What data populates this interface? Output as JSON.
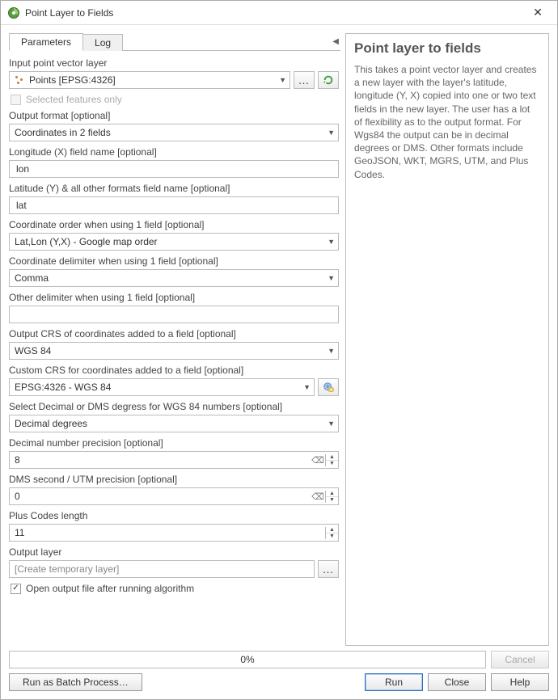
{
  "window": {
    "title": "Point Layer to Fields"
  },
  "tabs": {
    "parameters": "Parameters",
    "log": "Log"
  },
  "form": {
    "input_layer": {
      "label": "Input point vector layer",
      "value": "Points [EPSG:4326]"
    },
    "selected_only": {
      "label": "Selected features only",
      "checked": false,
      "enabled": false
    },
    "output_format": {
      "label": "Output format [optional]",
      "value": "Coordinates in 2 fields"
    },
    "lon_field": {
      "label": "Longitude (X) field name [optional]",
      "value": "lon"
    },
    "lat_field": {
      "label": "Latitude (Y) & all other formats field name [optional]",
      "value": "lat"
    },
    "coord_order": {
      "label": "Coordinate order when using 1 field [optional]",
      "value": "Lat,Lon (Y,X) - Google map order"
    },
    "coord_delim": {
      "label": "Coordinate delimiter when using 1 field [optional]",
      "value": "Comma"
    },
    "other_delim": {
      "label": "Other delimiter when using 1 field [optional]",
      "value": ""
    },
    "output_crs": {
      "label": "Output CRS of coordinates added to a field [optional]",
      "value": "WGS 84"
    },
    "custom_crs": {
      "label": "Custom CRS for coordinates added to a field [optional]",
      "value": "EPSG:4326 - WGS 84"
    },
    "dms_select": {
      "label": "Select Decimal or DMS degress for WGS 84 numbers [optional]",
      "value": "Decimal degrees"
    },
    "dec_precision": {
      "label": "Decimal number precision [optional]",
      "value": "8"
    },
    "dms_precision": {
      "label": "DMS second / UTM precision [optional]",
      "value": "0"
    },
    "plus_len": {
      "label": "Plus Codes length",
      "value": "11"
    },
    "output_layer": {
      "label": "Output layer",
      "placeholder": "[Create temporary layer]"
    },
    "open_output": {
      "label": "Open output file after running algorithm",
      "checked": true
    }
  },
  "help": {
    "title": "Point layer to fields",
    "body": "This takes a point vector layer and creates a new layer with the layer's latitude, longitude (Y, X) copied into one or two text fields in the new layer. The user has a lot of flexibility as to the output format. For Wgs84 the output can be in decimal degrees or DMS. Other formats include GeoJSON, WKT, MGRS, UTM, and Plus Codes."
  },
  "progress": {
    "text": "0%"
  },
  "buttons": {
    "cancel": "Cancel",
    "batch": "Run as Batch Process…",
    "run": "Run",
    "close": "Close",
    "help": "Help"
  }
}
